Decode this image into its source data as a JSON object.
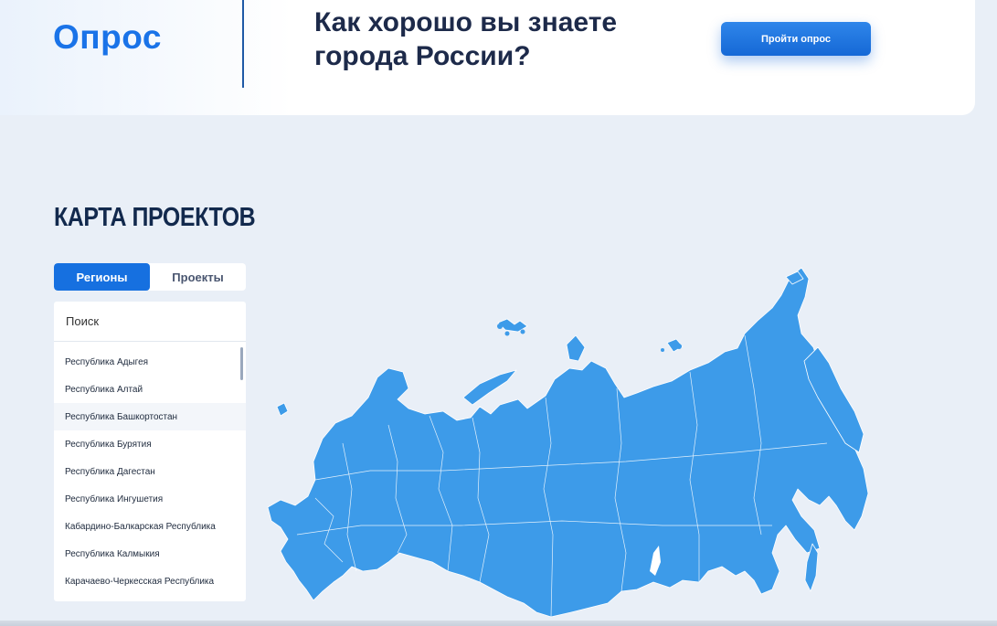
{
  "survey": {
    "logo": "Опрос",
    "question": "Как хорошо вы знаете города России?",
    "button_label": "Пройти опрос"
  },
  "section": {
    "title": "КАРТА ПРОЕКТОВ"
  },
  "tabs": [
    {
      "label": "Регионы",
      "active": true
    },
    {
      "label": "Проекты",
      "active": false
    }
  ],
  "search": {
    "placeholder": "Поиск"
  },
  "regions": [
    "Республика Адыгея",
    "Республика Алтай",
    "Республика Башкортостан",
    "Республика Бурятия",
    "Республика Дагестан",
    "Республика Ингушетия",
    "Кабардино-Балкарская Республика",
    "Республика Калмыкия",
    "Карачаево-Черкесская Республика"
  ],
  "colors": {
    "accent": "#1670e0",
    "map_fill": "#3d9be9",
    "map_border": "#ffffff",
    "heading": "#12294d"
  }
}
